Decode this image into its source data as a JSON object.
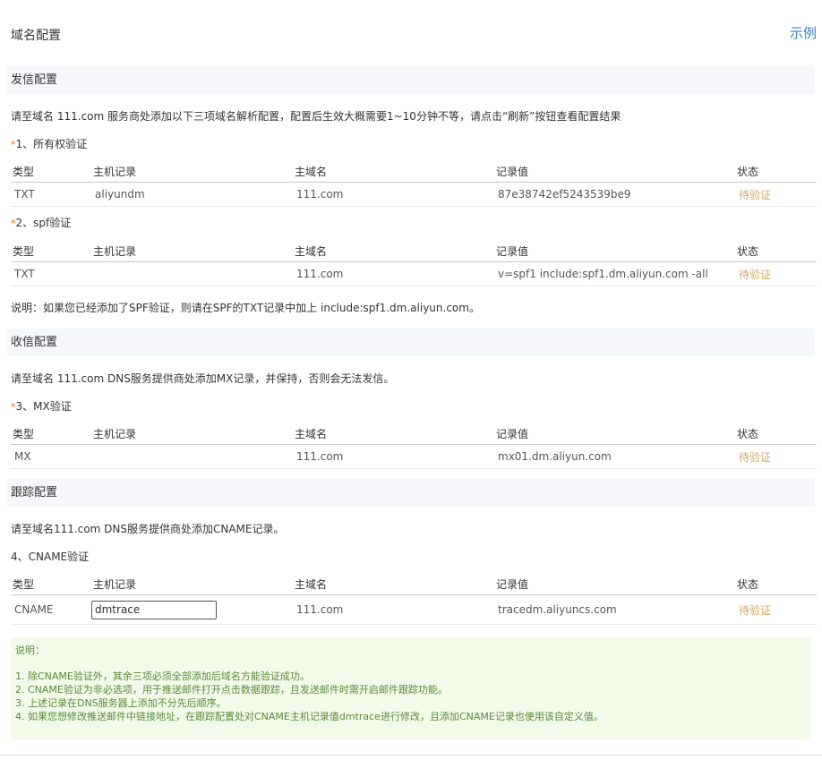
{
  "page": {
    "title": "域名配置",
    "example_link": "示例"
  },
  "sending": {
    "header": "发信配置",
    "instruction": "请至域名 111.com 服务商处添加以下三项域名解析配置，配置后生效大概需要1~10分钟不等，请点击“刷新”按钮查看配置结果",
    "ownership": {
      "title": "1、所有权验证",
      "columns": [
        "类型",
        "主机记录",
        "主域名",
        "记录值",
        "状态"
      ],
      "row": {
        "type": "TXT",
        "host": "aliyundm",
        "domain": "111.com",
        "value": "87e38742ef5243539be9",
        "status": "待验证"
      }
    },
    "spf": {
      "title": "2、spf验证",
      "columns": [
        "类型",
        "主机记录",
        "主域名",
        "记录值",
        "状态"
      ],
      "row": {
        "type": "TXT",
        "host": "",
        "domain": "111.com",
        "value": "v=spf1 include:spf1.dm.aliyun.com -all",
        "status": "待验证"
      }
    },
    "note": "说明：如果您已经添加了SPF验证，则请在SPF的TXT记录中加上 include:spf1.dm.aliyun.com。"
  },
  "receiving": {
    "header": "收信配置",
    "instruction": "请至域名 111.com DNS服务提供商处添加MX记录，并保持，否则会无法发信。",
    "mx": {
      "title": "3、MX验证",
      "columns": [
        "类型",
        "主机记录",
        "主域名",
        "记录值",
        "状态"
      ],
      "row": {
        "type": "MX",
        "host": "",
        "domain": "111.com",
        "value": "mx01.dm.aliyun.com",
        "status": "待验证"
      }
    }
  },
  "tracking": {
    "header": "跟踪配置",
    "instruction": "请至域名111.com DNS服务提供商处添加CNAME记录。",
    "cname": {
      "title": "4、CNAME验证",
      "columns": [
        "类型",
        "主机记录",
        "主域名",
        "记录值",
        "状态"
      ],
      "row": {
        "type": "CNAME",
        "host_input_value": "dmtrace",
        "domain": "111.com",
        "value": "tracedm.aliyuncs.com",
        "status": "待验证"
      }
    }
  },
  "notes": {
    "title": "说明：",
    "items": [
      "1. 除CNAME验证外，其余三项必须全部添加后域名方能验证成功。",
      "2. CNAME验证为非必选项，用于推送邮件打开点击数据跟踪，且发送邮件时需开启邮件跟踪功能。",
      "3. 上述记录在DNS服务器上添加不分先后顺序。",
      "4. 如果您想修改推送邮件中链接地址，在跟踪配置处对CNAME主机记录值dmtrace进行修改，且添加CNAME记录也使用该自定义值。"
    ]
  },
  "required_marker": "*",
  "colors": {
    "accent_link": "#3a7fc8",
    "pending_status": "#d9a562",
    "required_star": "#ff6a00",
    "notes_bg": "#f2faea",
    "notes_text": "#5a8a3a"
  }
}
